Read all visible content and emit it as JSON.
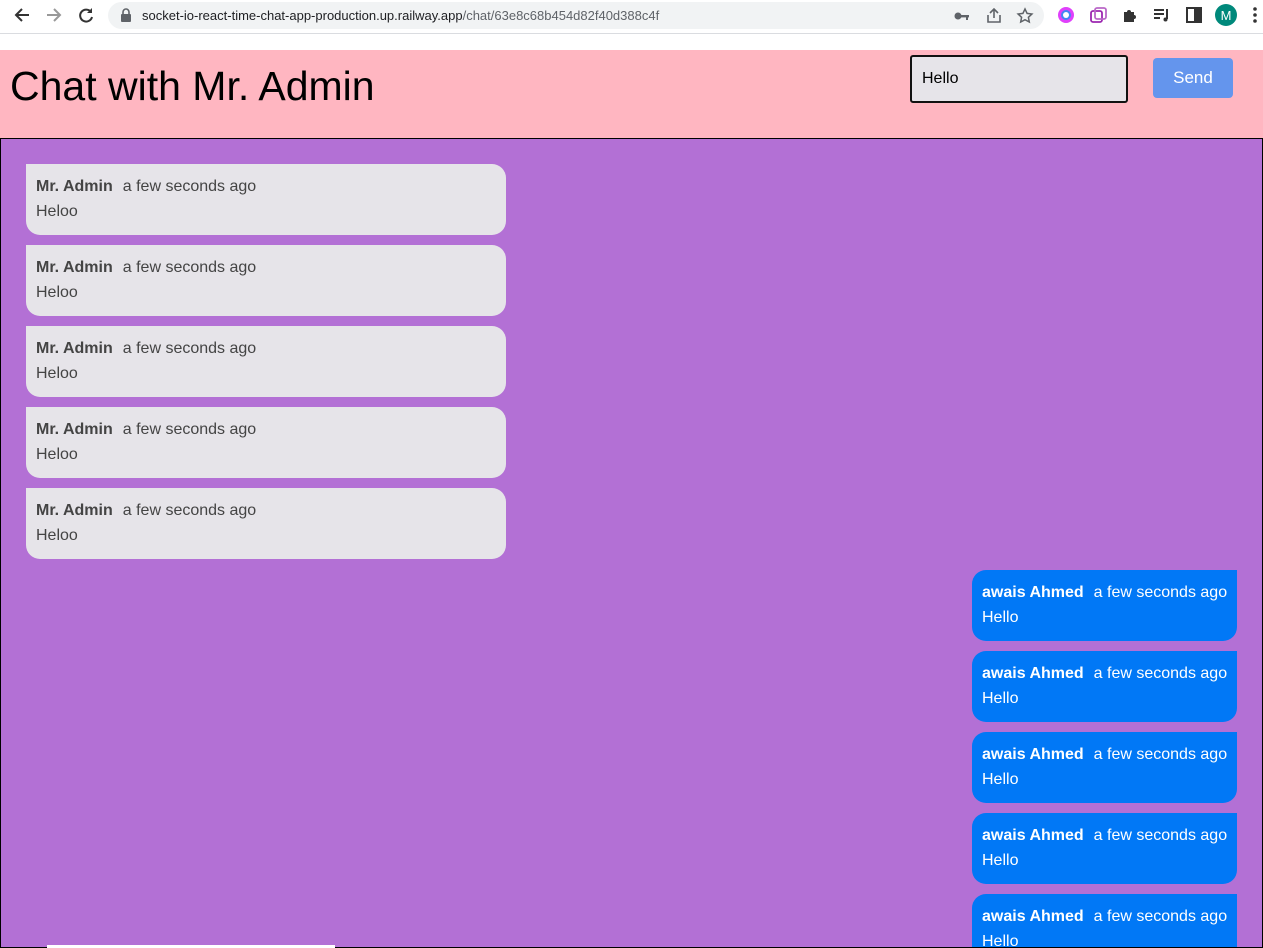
{
  "browser": {
    "url_host": "socket-io-react-time-chat-app-production.up.railway.app",
    "url_path": "/chat/63e8c68b454d82f40d388c4f",
    "profile_initial": "M"
  },
  "chat": {
    "title": "Chat with Mr. Admin",
    "input_value": "Hello",
    "send_label": "Send",
    "colors": {
      "header_bg": "#ffb6c1",
      "chat_bg": "#b370d5",
      "other_bubble": "#e6e4e9",
      "my_bubble": "#0178f6",
      "send_button": "#6495ed"
    },
    "messages_other": [
      {
        "author": "Mr. Admin",
        "time": "a few seconds ago",
        "text": "Heloo"
      },
      {
        "author": "Mr. Admin",
        "time": "a few seconds ago",
        "text": "Heloo"
      },
      {
        "author": "Mr. Admin",
        "time": "a few seconds ago",
        "text": "Heloo"
      },
      {
        "author": "Mr. Admin",
        "time": "a few seconds ago",
        "text": "Heloo"
      },
      {
        "author": "Mr. Admin",
        "time": "a few seconds ago",
        "text": "Heloo"
      }
    ],
    "messages_mine": [
      {
        "author": "awais Ahmed",
        "time": "a few seconds ago",
        "text": "Hello"
      },
      {
        "author": "awais Ahmed",
        "time": "a few seconds ago",
        "text": "Hello"
      },
      {
        "author": "awais Ahmed",
        "time": "a few seconds ago",
        "text": "Hello"
      },
      {
        "author": "awais Ahmed",
        "time": "a few seconds ago",
        "text": "Hello"
      },
      {
        "author": "awais Ahmed",
        "time": "a few seconds ago",
        "text": "Hello"
      }
    ]
  }
}
